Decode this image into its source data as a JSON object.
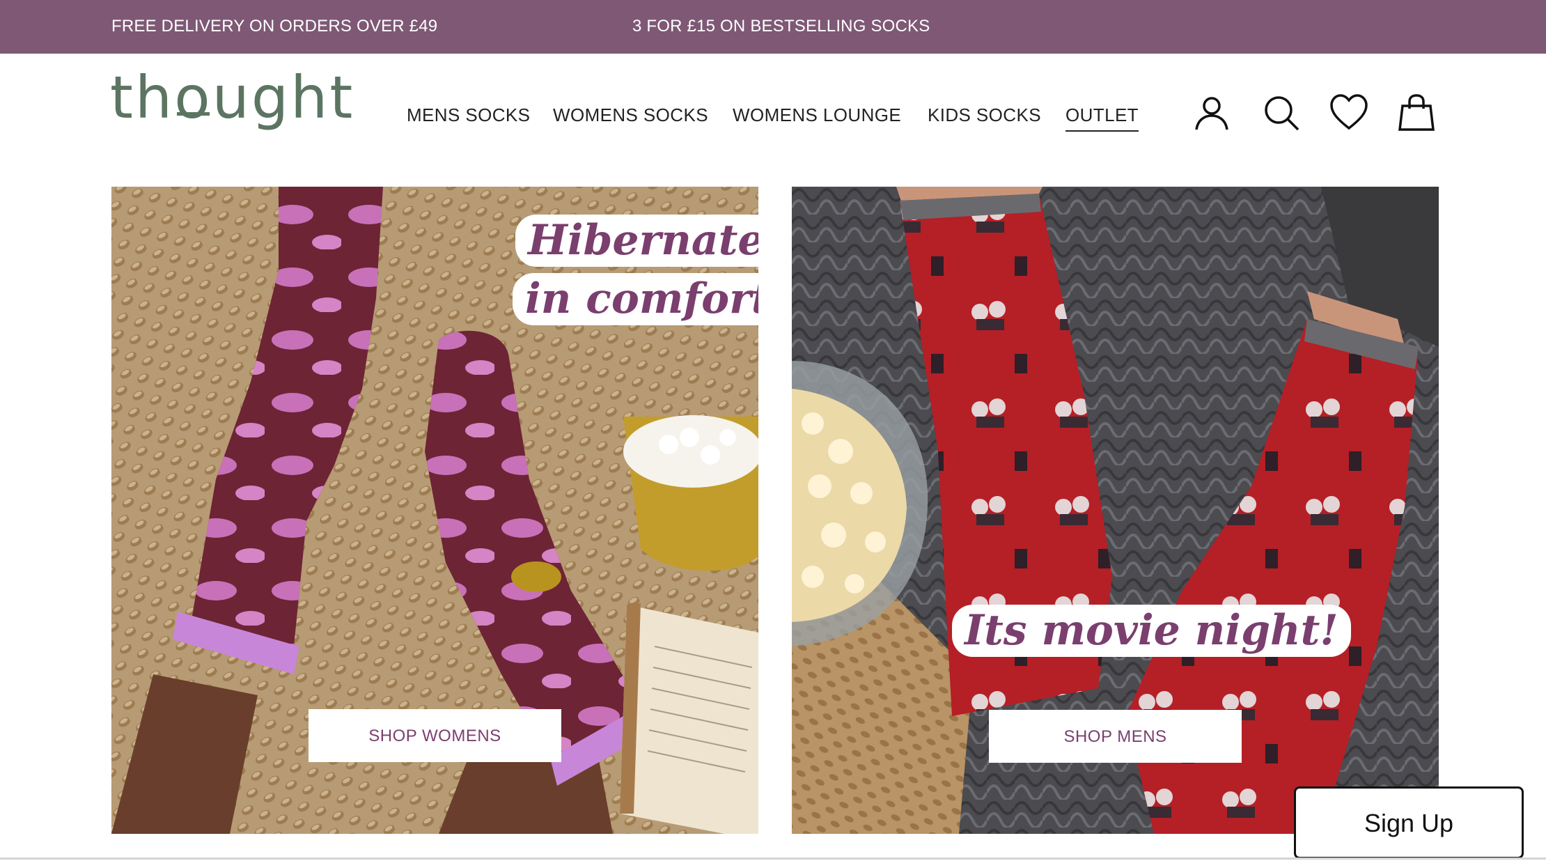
{
  "promo": {
    "message_1": "FREE DELIVERY ON ORDERS OVER £49",
    "message_2": "3 FOR £15 ON BESTSELLING SOCKS"
  },
  "header": {
    "logo_text_a": "th",
    "logo_text_o": "o",
    "logo_text_b": "ught",
    "nav": [
      {
        "label": "MENS SOCKS"
      },
      {
        "label": "WOMENS SOCKS"
      },
      {
        "label": "WOMENS LOUNGE"
      },
      {
        "label": "KIDS SOCKS"
      },
      {
        "label": "OUTLET",
        "active": true
      }
    ],
    "icons": [
      "account-icon",
      "search-icon",
      "wishlist-heart-icon",
      "shopping-bag-icon"
    ]
  },
  "hero": {
    "women": {
      "headline_line1": "Hibernate",
      "headline_line2": "in comfort",
      "button": "SHOP WOMENS"
    },
    "men": {
      "headline": "Its movie night!",
      "button": "SHOP MENS"
    }
  },
  "signup": {
    "label": "Sign Up"
  },
  "colors": {
    "promo_bar": "#7e5875",
    "logo": "#5c7563",
    "headline_text": "#7a3f6e"
  }
}
